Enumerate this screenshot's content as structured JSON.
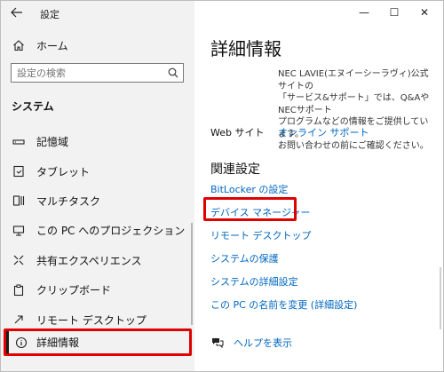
{
  "window": {
    "app_title": "設定",
    "controls": {
      "minimize": "—",
      "maximize": "☐",
      "close": "✕"
    }
  },
  "sidebar": {
    "home_label": "ホーム",
    "search_placeholder": "設定の検索",
    "section_title": "システム",
    "items": [
      {
        "label": "記憶域",
        "icon": "storage-icon"
      },
      {
        "label": "タブレット",
        "icon": "tablet-icon"
      },
      {
        "label": "マルチタスク",
        "icon": "multitask-icon"
      },
      {
        "label": "この PC へのプロジェクション",
        "icon": "projection-icon"
      },
      {
        "label": "共有エクスペリエンス",
        "icon": "shared-experiences-icon"
      },
      {
        "label": "クリップボード",
        "icon": "clipboard-icon"
      },
      {
        "label": "リモート デスクトップ",
        "icon": "remote-desktop-icon"
      }
    ],
    "active_item": {
      "label": "詳細情報",
      "icon": "info-icon"
    }
  },
  "main": {
    "title": "詳細情報",
    "support_text": [
      "NEC LAVIE(エヌイーシーラヴィ)公式サイトの",
      "「サービス&サポート」では、Q&AやNECサポート",
      "プログラムなどの情報をご提供しています。",
      "お問い合わせの前にご確認ください。"
    ],
    "web_label": "Web サイト",
    "web_link": "オンライン サポート",
    "related_title": "関連設定",
    "related_links": [
      "BitLocker の設定",
      "デバイス マネージャー",
      "リモート デスクトップ",
      "システムの保護",
      "システムの詳細設定",
      "この PC の名前を変更 (詳細設定)"
    ],
    "help_label": "ヘルプを表示"
  }
}
